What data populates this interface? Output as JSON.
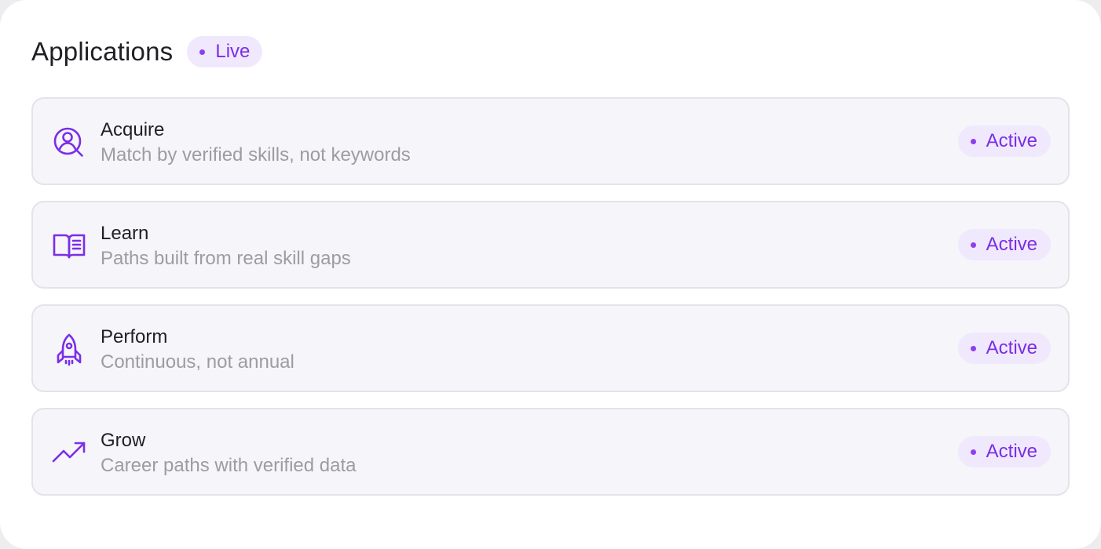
{
  "header": {
    "title": "Applications",
    "status": "Live"
  },
  "applications": [
    {
      "name": "Acquire",
      "description": "Match by verified skills, not keywords",
      "status": "Active",
      "icon": "user-search-icon"
    },
    {
      "name": "Learn",
      "description": "Paths built from real skill gaps",
      "status": "Active",
      "icon": "open-book-icon"
    },
    {
      "name": "Perform",
      "description": "Continuous, not annual",
      "status": "Active",
      "icon": "rocket-icon"
    },
    {
      "name": "Grow",
      "description": "Career paths with verified data",
      "status": "Active",
      "icon": "trending-up-icon"
    }
  ],
  "colors": {
    "accent": "#7a2ee6",
    "pill_background": "#f0e8fd",
    "row_background": "#f5f5fa",
    "row_border": "#e3e3ea",
    "title_text": "#1f1f24",
    "muted_text": "#9c9ca4"
  }
}
